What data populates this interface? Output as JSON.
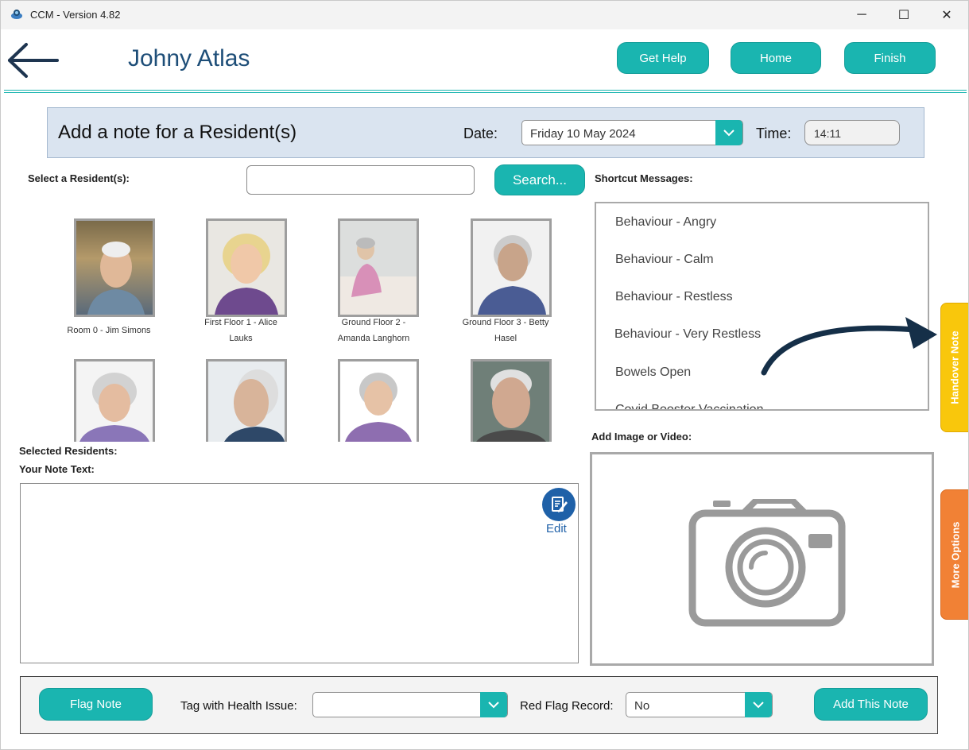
{
  "window": {
    "title": "CCM - Version 4.82",
    "min": "─",
    "max": "☐",
    "close": "✕"
  },
  "header": {
    "resident_name": "Johny Atlas",
    "buttons": {
      "help": "Get Help",
      "home": "Home",
      "finish": "Finish"
    }
  },
  "note_panel": {
    "title": "Add a note for a Resident(s)",
    "date_label": "Date:",
    "date_value": "Friday 10 May 2024",
    "time_label": "Time:",
    "time_value": "14:11"
  },
  "select": {
    "label": "Select a Resident(s):",
    "search_value": "",
    "search_button": "Search..."
  },
  "residents": [
    {
      "caption_1": "Room 0 - Jim Simons",
      "caption_2": ""
    },
    {
      "caption_1": "First Floor 1 - Alice",
      "caption_2": "Lauks"
    },
    {
      "caption_1": "Ground Floor 2 -",
      "caption_2": "Amanda Langhorn"
    },
    {
      "caption_1": "Ground Floor 3 - Betty",
      "caption_2": "Hasel"
    },
    {
      "caption_1": "",
      "caption_2": ""
    },
    {
      "caption_1": "",
      "caption_2": ""
    },
    {
      "caption_1": "",
      "caption_2": ""
    },
    {
      "caption_1": "",
      "caption_2": ""
    }
  ],
  "shortcuts": {
    "label": "Shortcut Messages:",
    "items": [
      "Behaviour - Angry",
      "Behaviour - Calm",
      "Behaviour - Restless",
      "Behaviour - Very Restless",
      "Bowels Open",
      "Covid Booster Vaccination"
    ]
  },
  "side_tabs": {
    "handover": "Handover Note",
    "more": "More Options"
  },
  "note": {
    "selected_label": "Selected Residents:",
    "text_label": "Your Note Text:",
    "edit_label": "Edit"
  },
  "media": {
    "label": "Add Image or Video:"
  },
  "bottom": {
    "flag_button": "Flag Note",
    "health_label": "Tag with Health Issue:",
    "health_value": "",
    "red_flag_label": "Red Flag Record:",
    "red_flag_value": "No",
    "add_button": "Add This Note"
  },
  "colors": {
    "accent": "#1ab5b0",
    "title": "#1e4e78",
    "handover": "#f9c70c",
    "more": "#f18135",
    "edit": "#1f61a8"
  }
}
